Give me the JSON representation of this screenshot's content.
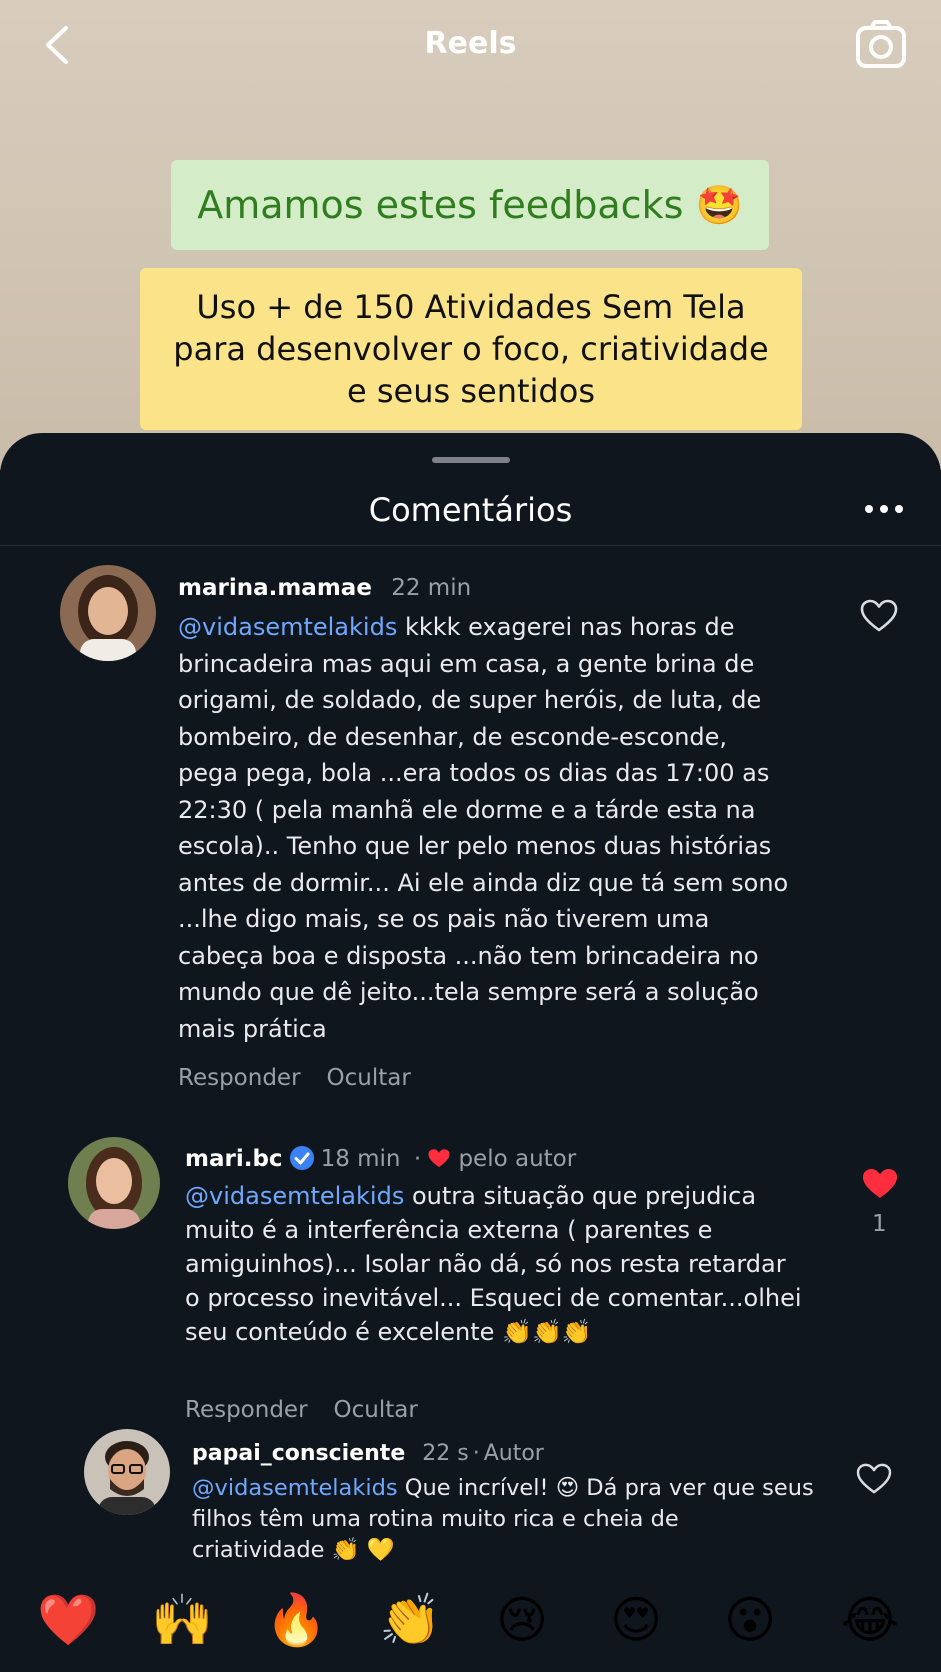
{
  "header": {
    "title": "Reels",
    "back_icon": "chevron-left-icon",
    "camera_icon": "camera-icon"
  },
  "cards": {
    "headline": "Amamos estes feedbacks 🤩",
    "subline": "Uso + de 150 Atividades Sem Tela\npara desenvolver o foco, criatividade\ne seus sentidos"
  },
  "sheet": {
    "title": "Comentários"
  },
  "comments": [
    {
      "user": "marina.mamae",
      "time": "22 min",
      "mention": "@vidasemtelakids",
      "text": " kkkk exagerei nas horas de\nbrincadeira mas aqui em casa,  a gente brina de\norigami, de soldado, de super heróis, de luta, de\nbombeiro, de desenhar,  de esconde-esconde,\npega pega, bola ...era todos os dias das 17:00 as\n22:30 ( pela manhã ele dorme e a tárde esta na\nescola).. Tenho que ler pelo menos duas histórias\nantes de dormir... Ai ele ainda diz que tá sem sono\n...lhe digo mais, se os pais não tiverem uma\ncabeça boa e disposta ...não tem brincadeira no\nmundo que dê jeito...tela sempre será a solução\nmais prática",
      "reply": "Responder",
      "hide": "Ocultar"
    },
    {
      "user": "mari.bc",
      "time": "18 min",
      "extra": "pelo autor",
      "mention": "@vidasemtelakids",
      "text": " outra situação que prejudica\nmuito é a interferência externa ( parentes e\namiguinhos)... Isolar não dá, só nos resta retardar\no processo inevitável... Esqueci de comentar...olhei\nseu conteúdo é excelente 👏👏👏",
      "reply": "Responder",
      "hide": "Ocultar",
      "likes": "1"
    },
    {
      "user": "papai_consciente",
      "time": "22 s",
      "extra": "Autor",
      "mention": "@vidasemtelakids",
      "text": " Que incrível! 😍 Dá pra ver que seus\nfilhos têm uma rotina muito rica e cheia de\ncriatividade 👏 💛"
    }
  ],
  "reactions": [
    "❤️",
    "🙌",
    "🔥",
    "👏",
    "😢",
    "😍",
    "😮",
    "😂"
  ],
  "colors": {
    "mention": "#6ea8ff",
    "like_red": "#ff2d3d",
    "sheet_bg": "#10161d"
  }
}
